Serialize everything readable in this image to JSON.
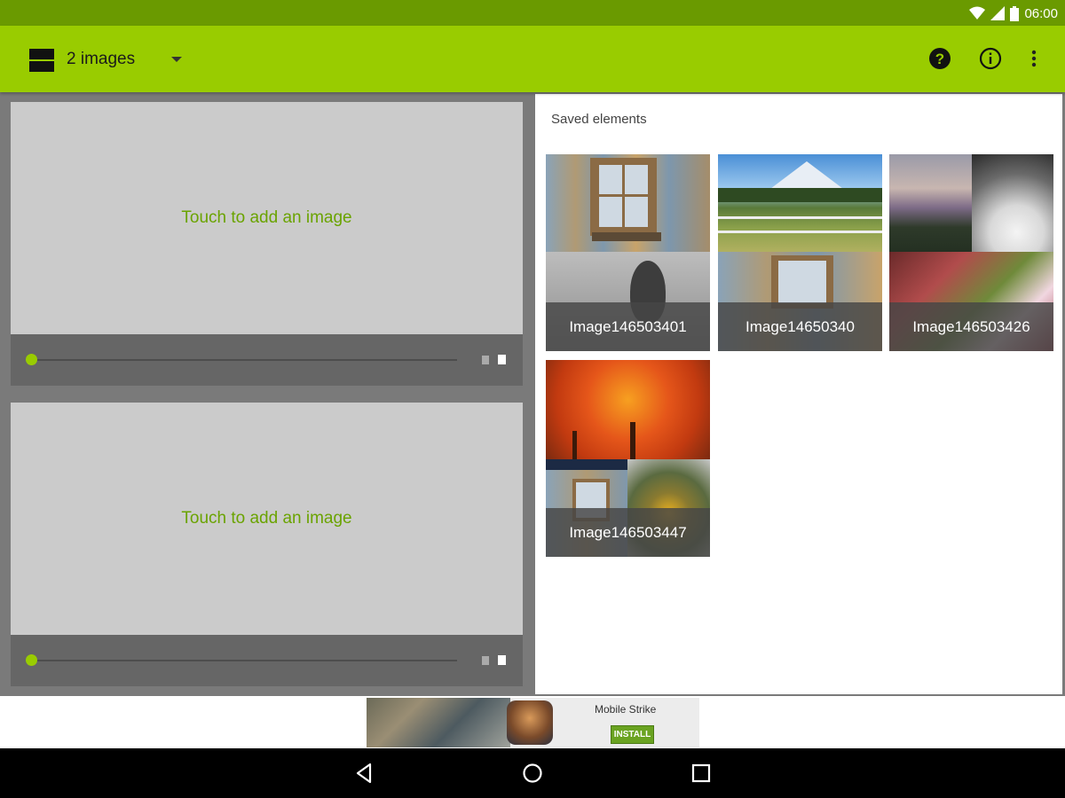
{
  "status_bar": {
    "time": "06:00",
    "icons": [
      "wifi-icon",
      "signal-icon",
      "battery-icon"
    ]
  },
  "toolbar": {
    "layout_icon": "two-rows-layout-icon",
    "title": "2 images",
    "actions": [
      "help-icon",
      "info-icon",
      "more-vert-icon"
    ]
  },
  "slots": [
    {
      "hint": "Touch to add an image"
    },
    {
      "hint": "Touch to add an image"
    }
  ],
  "saved": {
    "title": "Saved elements",
    "items": [
      {
        "label": "Image146503401"
      },
      {
        "label": "Image14650340"
      },
      {
        "label": "Image146503426"
      },
      {
        "label": "Image146503447"
      }
    ]
  },
  "ad": {
    "name": "Mobile Strike",
    "cta": "INSTALL"
  },
  "nav_bar": {
    "buttons": [
      "back-icon",
      "home-icon",
      "recents-icon"
    ]
  },
  "colors": {
    "accent": "#99cc00",
    "status": "#6a9a00",
    "hint_text": "#6aa300"
  }
}
